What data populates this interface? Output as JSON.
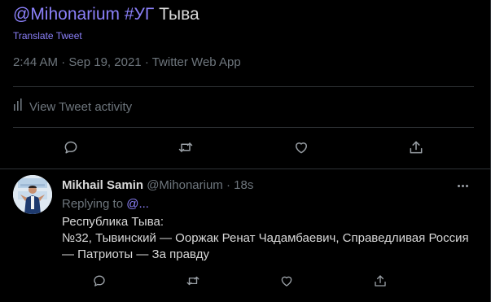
{
  "tweet": {
    "mention": "@Mihonarium",
    "hashtag": "#УГ",
    "text": "Тыва",
    "translate_label": "Translate Tweet",
    "time": "2:44 AM",
    "date": "Sep 19, 2021",
    "source": "Twitter Web App",
    "separator": "·",
    "activity_label": "View Tweet activity"
  },
  "reply": {
    "author_name": "Mikhail Samin",
    "author_handle": "@Mihonarium",
    "separator": "·",
    "time_ago": "18s",
    "replying_prefix": "Replying to",
    "replying_to": "@...",
    "lines": [
      "Республика Тыва:",
      "№32, Тывинский — Ооржак Ренат Чадамбаевич, Справедливая Россия",
      "— Патриоты — За правду"
    ]
  },
  "icons": {
    "reply": "reply-icon",
    "retweet": "retweet-icon",
    "like": "heart-icon",
    "share": "share-icon",
    "analytics": "analytics-icon",
    "more": "more-icon"
  },
  "colors": {
    "background": "#000000",
    "text": "#d9d9d9",
    "secondary": "#6e767d",
    "accent": "#8b80f9",
    "divider": "#2f3336"
  }
}
